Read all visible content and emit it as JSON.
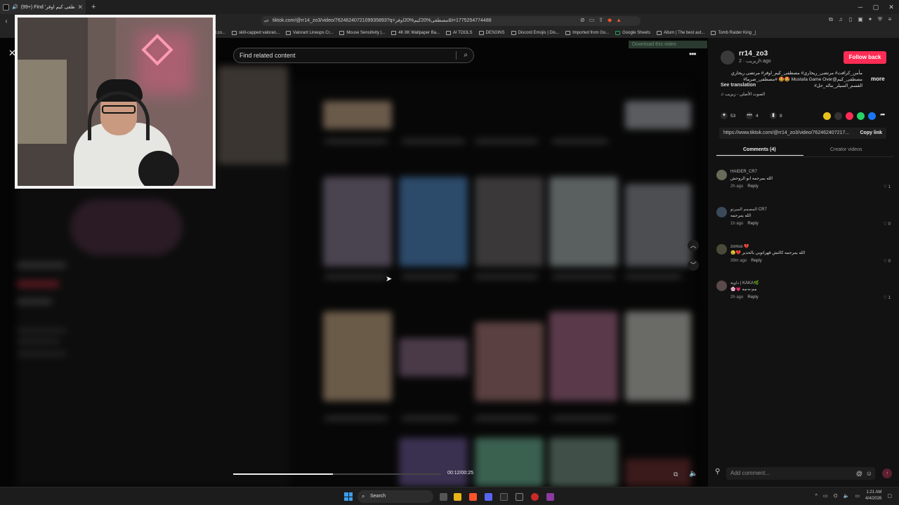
{
  "browser": {
    "tab_title": "(99+) Find 'مصطفى كيم اوفر'",
    "new_tab": "+",
    "window_controls": [
      "─",
      "▢",
      "✕"
    ],
    "url": "tiktok.com/@rr14_zo3/video/7624624072109935893?q=مصطفى%20كيم%20اوفر&t=1775254774488",
    "bookmarks": [
      "Tot.co...",
      "skill-capped valoran...",
      "Valorant Lineups Cr...",
      "Mouse Sensitivity |...",
      "4K 8K Wallpaper Ba...",
      "AI TOOLS",
      "DESGINS",
      "Discord Emojis | Dis...",
      "Imported from Go...",
      "Google Sheets",
      "Aitum | The best aut...",
      "Tomb Raider King _|"
    ]
  },
  "player": {
    "search_placeholder": "Find related content",
    "download_label": "Download this video",
    "time": "00:12/00:25",
    "progress": 0.48
  },
  "author": {
    "username": "rr14_zo3",
    "subtitle": "زيزيب · 2h ago",
    "follow_label": "Follow back"
  },
  "post": {
    "caption": "مأمن_كرافت# مرتضى_ريحاري# مصطفى_كيم_اوفر# مرتضى ريحاري مصطفى_كيم@Mustafa Game Over 🤩🤩 #مصطفى_صرما# القسم_السيلر_ماله_حل#",
    "see_translation": "See translation",
    "more": "more",
    "sound": "♫  الصوت الأصلي - زيزيب",
    "likes": "53",
    "comments_count": "4",
    "saves": "8",
    "link": "https://www.tiktok.com/@rr14_zo3/video/762462407217...",
    "copy_link": "Copy link"
  },
  "tabs": {
    "comments": "Comments (4)",
    "creator_videos": "Creator videos"
  },
  "comments": [
    {
      "name": "HAIDER_CR7",
      "text": "الله يمرحمه ابو الروحش",
      "time": "2h ago",
      "reply": "Reply",
      "likes": "♡ 1"
    },
    {
      "name": "المصمم الميرتو CR7",
      "text": "الله يمرحمه",
      "time": "1h ago",
      "reply": "Reply",
      "likes": "♡ 0"
    },
    {
      "name": "zomus 💔",
      "text": "😢💔 الله يمرحمه كالنش قهراتوبي يالحدير",
      "time": "39m ago",
      "reply": "Reply",
      "likes": "♡ 0"
    },
    {
      "name": "داوية | KAKA🌿",
      "text": "🌸💗 مم-ه-مه",
      "time": "2h ago",
      "reply": "Reply",
      "likes": "♡ 1"
    }
  ],
  "add_comment": {
    "placeholder": "Add comment..."
  },
  "taskbar": {
    "search_label": "Search",
    "time": "1:21 AM",
    "date": "4/4/2026"
  },
  "colors": {
    "accent": "#fe2c55",
    "windows_blue": "#3b9ded"
  }
}
